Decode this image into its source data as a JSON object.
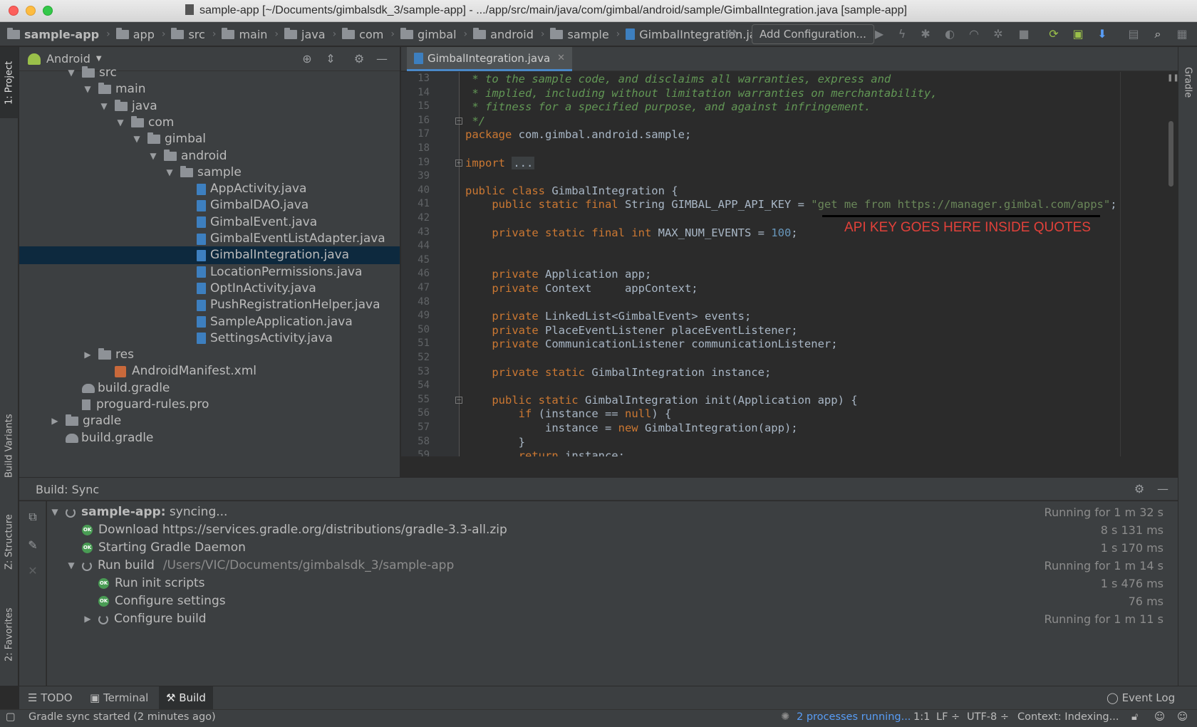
{
  "window": {
    "title": "sample-app [~/Documents/gimbalsdk_3/sample-app] - .../app/src/main/java/com/gimbal/android/sample/GimbalIntegration.java [sample-app]"
  },
  "breadcrumb": [
    "sample-app",
    "app",
    "src",
    "main",
    "java",
    "com",
    "gimbal",
    "android",
    "sample",
    "GimbalIntegration.java"
  ],
  "toolbar": {
    "add_configuration": "Add Configuration..."
  },
  "left_stripe": {
    "project": "1: Project",
    "build_variants": "Build Variants",
    "structure": "Z: Structure",
    "favorites": "2: Favorites"
  },
  "right_stripe": {
    "gradle": "Gradle"
  },
  "project_panel": {
    "view_selector": "Android",
    "tree": [
      {
        "label": "src",
        "depth": 2,
        "arrow": "▼",
        "icon": "folder"
      },
      {
        "label": "main",
        "depth": 3,
        "arrow": "▼",
        "icon": "folder"
      },
      {
        "label": "java",
        "depth": 4,
        "arrow": "▼",
        "icon": "folder"
      },
      {
        "label": "com",
        "depth": 5,
        "arrow": "▼",
        "icon": "folder"
      },
      {
        "label": "gimbal",
        "depth": 6,
        "arrow": "▼",
        "icon": "folder"
      },
      {
        "label": "android",
        "depth": 7,
        "arrow": "▼",
        "icon": "folder"
      },
      {
        "label": "sample",
        "depth": 8,
        "arrow": "▼",
        "icon": "folder"
      },
      {
        "label": "AppActivity.java",
        "depth": 9,
        "arrow": "",
        "icon": "java"
      },
      {
        "label": "GimbalDAO.java",
        "depth": 9,
        "arrow": "",
        "icon": "java"
      },
      {
        "label": "GimbalEvent.java",
        "depth": 9,
        "arrow": "",
        "icon": "java"
      },
      {
        "label": "GimbalEventListAdapter.java",
        "depth": 9,
        "arrow": "",
        "icon": "java"
      },
      {
        "label": "GimbalIntegration.java",
        "depth": 9,
        "arrow": "",
        "icon": "java",
        "selected": true
      },
      {
        "label": "LocationPermissions.java",
        "depth": 9,
        "arrow": "",
        "icon": "java"
      },
      {
        "label": "OptInActivity.java",
        "depth": 9,
        "arrow": "",
        "icon": "java"
      },
      {
        "label": "PushRegistrationHelper.java",
        "depth": 9,
        "arrow": "",
        "icon": "java"
      },
      {
        "label": "SampleApplication.java",
        "depth": 9,
        "arrow": "",
        "icon": "java"
      },
      {
        "label": "SettingsActivity.java",
        "depth": 9,
        "arrow": "",
        "icon": "java"
      },
      {
        "label": "res",
        "depth": 3,
        "arrow": "▶",
        "icon": "folder"
      },
      {
        "label": "AndroidManifest.xml",
        "depth": 4,
        "arrow": "",
        "icon": "xml"
      },
      {
        "label": "build.gradle",
        "depth": 2,
        "arrow": "",
        "icon": "gradle"
      },
      {
        "label": "proguard-rules.pro",
        "depth": 2,
        "arrow": "",
        "icon": "pro"
      },
      {
        "label": "gradle",
        "depth": 1,
        "arrow": "▶",
        "icon": "folder"
      },
      {
        "label": "build.gradle",
        "depth": 1,
        "arrow": "",
        "icon": "gradle"
      }
    ]
  },
  "editor": {
    "tab_label": "GimbalIntegration.java",
    "lines": [
      {
        "n": "13",
        "html": "<span class=\"cm\"> * to the sample code, and disclaims all warranties, express and</span>"
      },
      {
        "n": "14",
        "html": "<span class=\"cm\"> * implied, including without limitation warranties on merchantability,</span>"
      },
      {
        "n": "15",
        "html": "<span class=\"cm\"> * fitness for a specified purpose, and against infringement.</span>"
      },
      {
        "n": "16",
        "html": "<span class=\"cm\"> */</span>"
      },
      {
        "n": "17",
        "html": "<span class=\"kw\">package</span> com.gimbal.android.sample;"
      },
      {
        "n": "18",
        "html": ""
      },
      {
        "n": "19",
        "html": "<span class=\"kw\">import</span> <span class=\"fold-box\">...</span>"
      },
      {
        "n": "39",
        "html": ""
      },
      {
        "n": "40",
        "html": "<span class=\"kw\">public class</span> GimbalIntegration {"
      },
      {
        "n": "41",
        "html": "    <span class=\"kw\">public static final</span> String GIMBAL_APP_API_KEY = <span class=\"str\">\"get me from https://manager.gimbal.com/apps\"</span>;"
      },
      {
        "n": "42",
        "html": ""
      },
      {
        "n": "43",
        "html": "    <span class=\"kw\">private static final int</span> MAX_NUM_EVENTS = <span class=\"num\">100</span>;"
      },
      {
        "n": "44",
        "html": ""
      },
      {
        "n": "45",
        "html": ""
      },
      {
        "n": "46",
        "html": "    <span class=\"kw\">private</span> Application app;"
      },
      {
        "n": "47",
        "html": "    <span class=\"kw\">private</span> Context     appContext;"
      },
      {
        "n": "48",
        "html": ""
      },
      {
        "n": "49",
        "html": "    <span class=\"kw\">private</span> LinkedList&lt;GimbalEvent&gt; events;"
      },
      {
        "n": "50",
        "html": "    <span class=\"kw\">private</span> PlaceEventListener placeEventListener;"
      },
      {
        "n": "51",
        "html": "    <span class=\"kw\">private</span> CommunicationListener communicationListener;"
      },
      {
        "n": "52",
        "html": ""
      },
      {
        "n": "53",
        "html": "    <span class=\"kw\">private static</span> GimbalIntegration instance;"
      },
      {
        "n": "54",
        "html": ""
      },
      {
        "n": "55",
        "html": "    <span class=\"kw\">public static</span> GimbalIntegration init(Application app) {"
      },
      {
        "n": "56",
        "html": "        <span class=\"kw\">if</span> (instance == <span class=\"kw\">null</span>) {"
      },
      {
        "n": "57",
        "html": "            instance = <span class=\"kw\">new</span> GimbalIntegration(app);"
      },
      {
        "n": "58",
        "html": "        }"
      },
      {
        "n": "59",
        "html": "        <span class=\"kw\">return</span> instance;"
      }
    ],
    "annotation": "API KEY GOES HERE INSIDE QUOTES"
  },
  "build": {
    "title": "Build: Sync",
    "rows": [
      {
        "label": "sample-app:",
        "suffix": " syncing...",
        "path": "",
        "status": "spin",
        "depth": 0,
        "arrow": "▼",
        "time": "Running for 1 m 32 s"
      },
      {
        "label": "Download https://services.gradle.org/distributions/gradle-3.3-all.zip",
        "suffix": "",
        "path": "",
        "status": "ok",
        "depth": 1,
        "arrow": "",
        "time": "8 s 131 ms"
      },
      {
        "label": "Starting Gradle Daemon",
        "suffix": "",
        "path": "",
        "status": "ok",
        "depth": 1,
        "arrow": "",
        "time": "1 s 170 ms"
      },
      {
        "label": "Run build",
        "suffix": "",
        "path": "/Users/VIC/Documents/gimbalsdk_3/sample-app",
        "status": "spin",
        "depth": 1,
        "arrow": "▼",
        "time": "Running for 1 m 14 s"
      },
      {
        "label": "Run init scripts",
        "suffix": "",
        "path": "",
        "status": "ok",
        "depth": 2,
        "arrow": "",
        "time": "1 s 476 ms"
      },
      {
        "label": "Configure settings",
        "suffix": "",
        "path": "",
        "status": "ok",
        "depth": 2,
        "arrow": "",
        "time": "76 ms"
      },
      {
        "label": "Configure build",
        "suffix": "",
        "path": "",
        "status": "spin",
        "depth": 2,
        "arrow": "▶",
        "time": "Running for 1 m 11 s"
      }
    ]
  },
  "bottom_tabs": {
    "todo": "TODO",
    "terminal": "Terminal",
    "build": "Build",
    "event_log": "Event Log"
  },
  "status": {
    "message": "Gradle sync started (2 minutes ago)",
    "processes": "2 processes running...",
    "position": "1:1",
    "line_sep": "LF ÷",
    "encoding": "UTF-8 ÷",
    "context": "Context: Indexing..."
  },
  "ok_text": "OK"
}
